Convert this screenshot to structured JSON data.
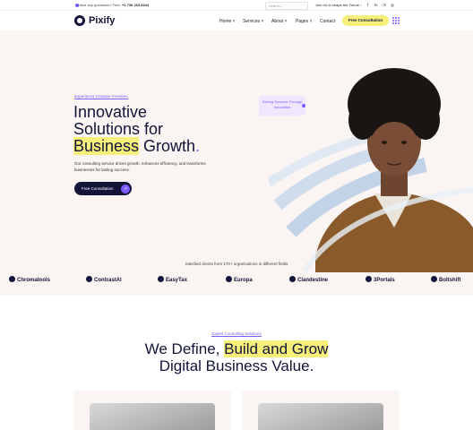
{
  "topbar": {
    "question": "Have any questions? Free:",
    "phone": "+1 730 263 8444",
    "search_placeholder": "Search...",
    "join_text": "Join Us to shape the Future",
    "social": [
      "f",
      "in",
      "X",
      "◎"
    ]
  },
  "header": {
    "brand": "Pixify",
    "nav": [
      "Home",
      "Services",
      "About",
      "Pages",
      "Contact"
    ],
    "cta": "Free Consultation"
  },
  "hero": {
    "eyebrow": "Experience Creative Freedom",
    "title_line1": "Innovative",
    "title_line2": "Solutions for",
    "title_hl": "Business",
    "title_rest": " Growth",
    "title_dot": ".",
    "description": "Our consulting service drives growth, enhances efficiency, and transforms businesses for lasting success.",
    "button": "Free Consultation",
    "bubble": "Driving Success Through Innovation"
  },
  "clients": {
    "title": "Satisfied clients from 170+ organisations in different fields",
    "logos": [
      "Chromatools",
      "ContrastAI",
      "EasyTax",
      "Europa",
      "Clandestine",
      "3Portals",
      "Boltshift"
    ]
  },
  "section2": {
    "eyebrow": "Expert Consulting Solutions",
    "title_pre": "We Define, ",
    "title_hl": "Build and Grow",
    "title_line2": "Digital Business Value."
  },
  "colors": {
    "accent": "#7c5cff",
    "highlight": "#f6f07a",
    "navy": "#12143a",
    "hero_bg": "#faf5f2"
  }
}
